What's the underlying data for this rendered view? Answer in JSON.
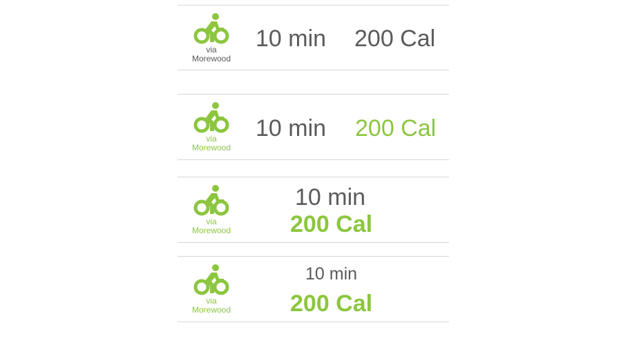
{
  "colors": {
    "accent_green": "#8cc63f",
    "text_gray": "#5a5a5a",
    "divider": "#d6d6d6"
  },
  "variants": [
    {
      "icon": "bicycle-icon",
      "via": "via",
      "route": "Morewood",
      "duration": "10 min",
      "calories": "200 Cal"
    },
    {
      "icon": "bicycle-icon",
      "via": "via",
      "route": "Morewood",
      "duration": "10 min",
      "calories": "200 Cal"
    },
    {
      "icon": "bicycle-icon",
      "via": "via",
      "route": "Morewood",
      "duration": "10 min",
      "calories": "200 Cal"
    },
    {
      "icon": "bicycle-icon",
      "via": "via",
      "route": "Morewood",
      "duration": "10 min",
      "calories": "200 Cal"
    }
  ]
}
